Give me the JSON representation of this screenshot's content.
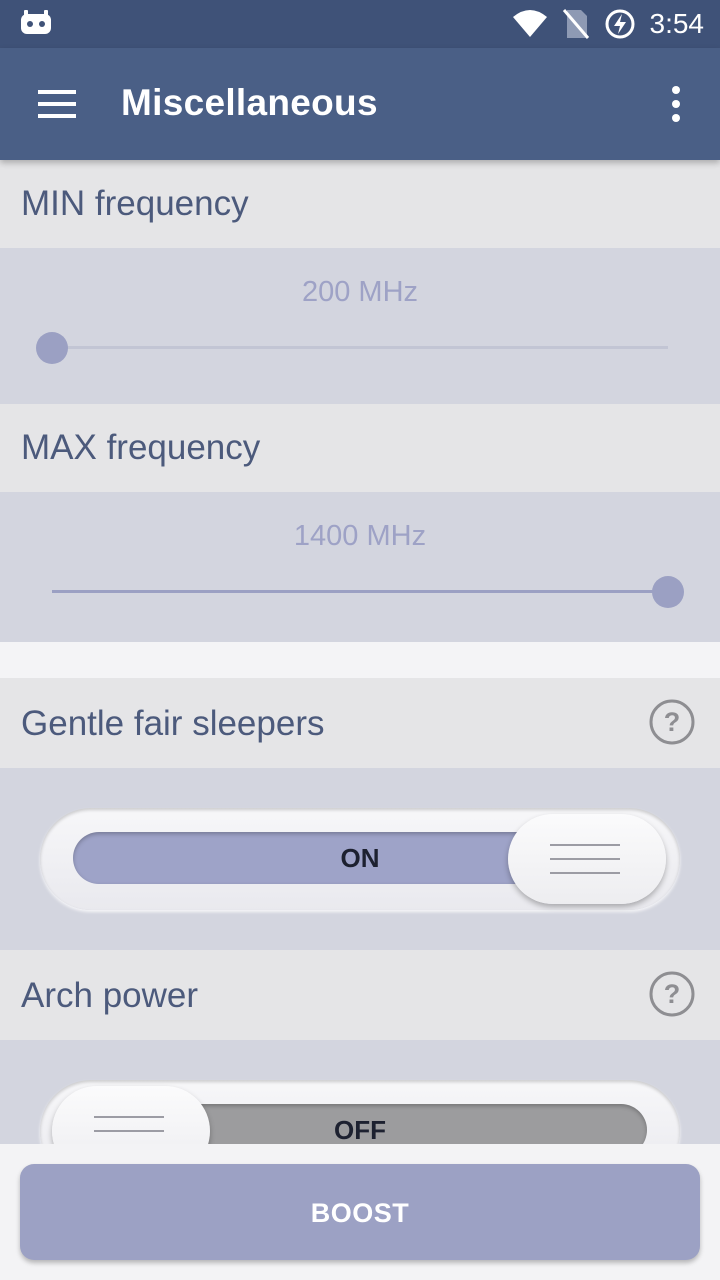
{
  "status_bar": {
    "time": "3:54",
    "icons": [
      "cyanogen-icon",
      "wifi-icon",
      "no-sim-icon",
      "battery-charging-icon"
    ]
  },
  "app_bar": {
    "title": "Miscellaneous",
    "menu_icon": "hamburger-menu-icon",
    "more_icon": "more-vert-icon"
  },
  "min_frequency": {
    "label": "MIN frequency",
    "value": "200 MHz",
    "position": 0.0
  },
  "max_frequency": {
    "label": "MAX frequency",
    "value": "1400 MHz",
    "position": 1.0
  },
  "gentle_fair_sleepers": {
    "label": "Gentle fair sleepers",
    "state": "ON",
    "help_icon": "help-circle-icon"
  },
  "arch_power": {
    "label": "Arch power",
    "state": "OFF",
    "help_icon": "help-circle-icon"
  },
  "boost_button": {
    "label": "BOOST"
  },
  "colors": {
    "status_bar": "#3f5278",
    "app_bar": "#4a5f86",
    "accent": "#9ca1c4",
    "label_text": "#4c5a7c",
    "toggle_off": "#9c9c9e"
  }
}
